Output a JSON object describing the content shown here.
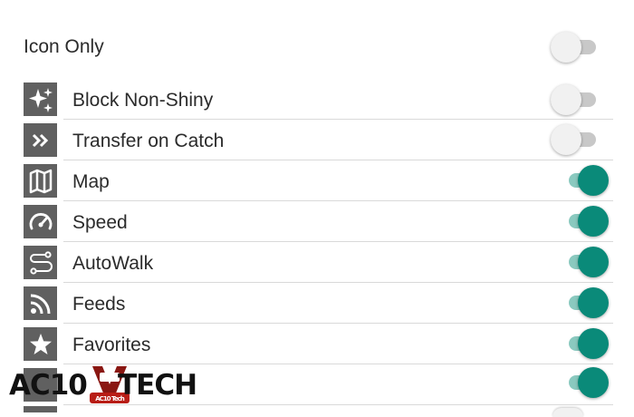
{
  "settings": {
    "icon_only": {
      "label": "Icon Only",
      "enabled": false
    },
    "items": [
      {
        "label": "Block Non-Shiny",
        "icon": "sparkles-icon",
        "enabled": false
      },
      {
        "label": "Transfer on Catch",
        "icon": "double-chevron-right-icon",
        "enabled": false
      },
      {
        "label": "Map",
        "icon": "map-icon",
        "enabled": true
      },
      {
        "label": "Speed",
        "icon": "speedometer-icon",
        "enabled": true
      },
      {
        "label": "AutoWalk",
        "icon": "route-icon",
        "enabled": true
      },
      {
        "label": "Feeds",
        "icon": "rss-feed-icon",
        "enabled": true
      },
      {
        "label": "Favorites",
        "icon": "star-icon",
        "enabled": true
      },
      {
        "label": "",
        "icon": "partial-icon",
        "enabled": true
      }
    ]
  },
  "colors": {
    "toggle_on_thumb": "#0a8a79",
    "toggle_on_track": "#8ac9bf",
    "toggle_off_thumb": "#f1f1f1",
    "toggle_off_track": "#c8c8c8",
    "icon_bg": "#606060",
    "divider": "#d9d9d9"
  },
  "watermark": {
    "left_text": "AC10",
    "right_text": "TECH",
    "badge_text": "AC10 Tech"
  }
}
